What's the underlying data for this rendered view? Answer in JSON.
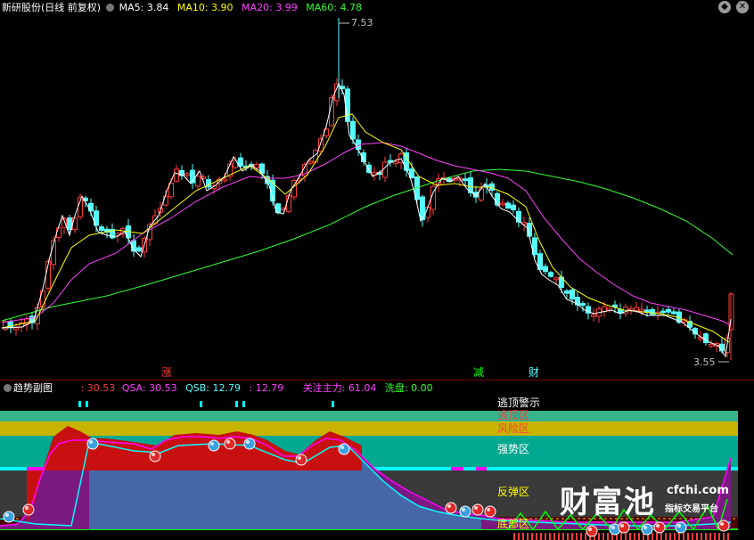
{
  "colors": {
    "up": "#ff3b3b",
    "down": "#54ffff",
    "ma5": "#ffffff",
    "ma10": "#ffff00",
    "ma20": "#ff40ff",
    "ma60": "#33ff33",
    "gray": "#c0c0c0",
    "cyan": "#00ffff",
    "green": "#00ff00",
    "magenta": "#ff00ff"
  },
  "main": {
    "title": "新研股份(日线 前复权)",
    "ma5_label": "MA5:",
    "ma5_value": "3.84",
    "ma10_label": "MA10:",
    "ma10_value": "3.90",
    "ma20_label": "MA20:",
    "ma20_value": "3.99",
    "ma60_label": "MA60:",
    "ma60_value": "4.78",
    "high_label": "7.53",
    "low_label": "3.55",
    "signals": [
      "涨",
      "减",
      "财"
    ]
  },
  "sub": {
    "title": "趋势副图",
    "v1": ": 30.53",
    "qsa_label": "QSA:",
    "qsa_value": "30.53",
    "qsb_label": "QSB:",
    "qsb_value": "12.79",
    "v4": ": 12.79",
    "gzzl_label": "关注主力:",
    "gzzl_value": "61.04",
    "xp_label": "洗盘:",
    "xp_value": "0.00",
    "zones": {
      "zone1": "逃顶警示",
      "zone2": "逃顶区",
      "zone3": "风险区",
      "zone4": "强势区",
      "zone5": "反弹区",
      "zone6": "底部区"
    }
  },
  "watermark": {
    "brand": "财富池",
    "site": "cfchi.com",
    "slogan": "指标交易平台"
  },
  "chart_data": [
    {
      "type": "candlestick",
      "title": "新研股份(日线 前复权)",
      "high_marker": 7.53,
      "low_marker": 3.55,
      "series": [
        {
          "name": "MA5",
          "last": 3.84
        },
        {
          "name": "MA10",
          "last": 3.9
        },
        {
          "name": "MA20",
          "last": 3.99
        },
        {
          "name": "MA60",
          "last": 4.78
        }
      ]
    },
    {
      "type": "area",
      "title": "趋势副图",
      "series": [
        {
          "name": "QSA",
          "last": 30.53
        },
        {
          "name": "QSB",
          "last": 12.79
        },
        {
          "name": "关注主力",
          "last": 61.04
        },
        {
          "name": "洗盘",
          "last": 0.0
        }
      ]
    }
  ]
}
